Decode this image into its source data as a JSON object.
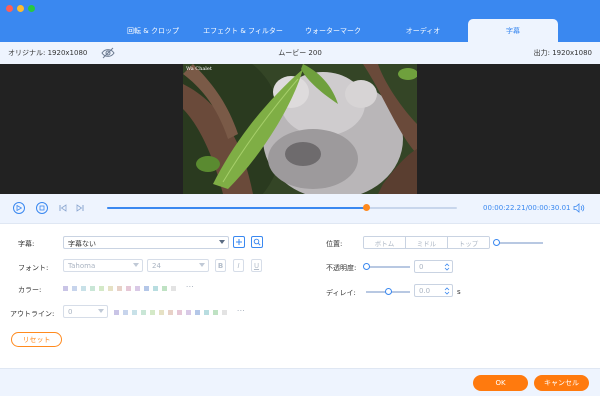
{
  "tabs": [
    {
      "label": "回転 & クロップ"
    },
    {
      "label": "エフェクト & フィルター"
    },
    {
      "label": "ウォーターマーク"
    },
    {
      "label": "オーディオ"
    },
    {
      "label": "字幕"
    }
  ],
  "infobar": {
    "original": "オリジナル: 1920x1080",
    "title": "ムービー 200",
    "output": "出力: 1920x1080"
  },
  "video": {
    "watermark": "Wa Chalet"
  },
  "playback": {
    "timecode": "00:00:22.21/00:00:30.01",
    "progress": 0.74
  },
  "subtitle": {
    "label": "字幕:",
    "value": "字幕ない"
  },
  "font": {
    "label": "フォント:",
    "family": "Tahoma",
    "size": "24",
    "bold": "B",
    "italic": "I",
    "underline": "U"
  },
  "color": {
    "label": "カラー:",
    "swatches": [
      "#c9c4e6",
      "#c7d4ec",
      "#c8e1e8",
      "#c9e6d6",
      "#d4e9c7",
      "#e6e1c4",
      "#e8d1c7",
      "#e6c7d6",
      "#d9c9e6",
      "#b4c7e8",
      "#b8dde0",
      "#bfe2c3",
      "#e3e3e3"
    ],
    "more": "···"
  },
  "outline": {
    "label": "アウトライン:",
    "value": "0",
    "swatches": [
      "#c9c4e6",
      "#c7d4ec",
      "#c8e1e8",
      "#c9e6d6",
      "#d4e9c7",
      "#e6e1c4",
      "#e8d1c7",
      "#e6c7d6",
      "#d9c9e6",
      "#b4c7e8",
      "#b8dde0",
      "#bfe2c3",
      "#e3e3e3"
    ],
    "more": "···"
  },
  "position": {
    "label": "位置:",
    "options": [
      "ボトム",
      "ミドル",
      "トップ"
    ]
  },
  "opacity": {
    "label": "不透明度:",
    "value": "0"
  },
  "delay": {
    "label": "ディレイ:",
    "value": "0.0",
    "unit": "s"
  },
  "buttons": {
    "reset": "リセット",
    "ok": "OK",
    "cancel": "キャンセル"
  },
  "colors": {
    "accent": "#3a88f0",
    "orange": "#ff7a0e",
    "panel": "#eef4fe"
  }
}
